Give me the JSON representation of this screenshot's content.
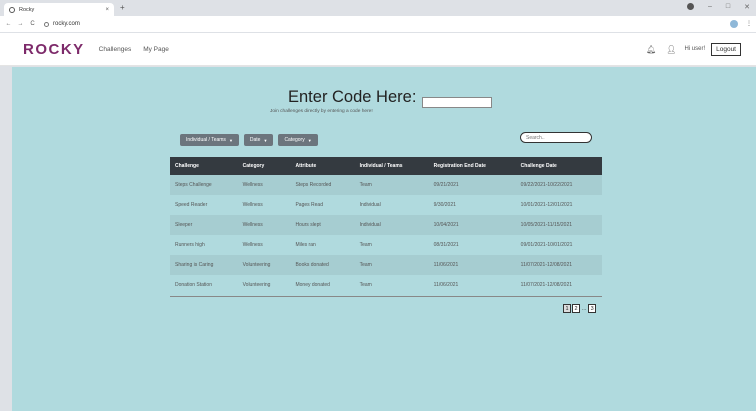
{
  "browser": {
    "tab_title": "Rocky",
    "tab_close": "×",
    "new_tab": "+",
    "url": "rocky.com",
    "nav_back": "←",
    "nav_forward": "→",
    "nav_reload": "C"
  },
  "navbar": {
    "brand": "ROCKY",
    "links": [
      "Challenges",
      "My Page"
    ],
    "greeting": "Hi user!",
    "logout_label": "Logout"
  },
  "main": {
    "heading": "Enter Code Here:",
    "subheading": "Join challenges directly by entering a code here!",
    "code_input_value": "",
    "filters": [
      {
        "label": "Individual / Teams"
      },
      {
        "label": "Date"
      },
      {
        "label": "Category"
      }
    ],
    "search_placeholder": "Search..",
    "table": {
      "columns": [
        "Challenge",
        "Category",
        "Attribute",
        "Individual / Teams",
        "Registration End Date",
        "Challenge Date"
      ],
      "rows": [
        [
          "Steps Challenge",
          "Wellness",
          "Steps Recorded",
          "Team",
          "09/21/2021",
          "09/22/2021-10/22/2021"
        ],
        [
          "Speed Reader",
          "Wellness",
          "Pages Read",
          "Individual",
          "9/30/2021",
          "10/01/2021-12/01/2021"
        ],
        [
          "Sleeper",
          "Wellness",
          "Hours slept",
          "Individual",
          "10/04/2021",
          "10/05/2021-11/15/2021"
        ],
        [
          "Runners high",
          "Wellness",
          "Miles ran",
          "Team",
          "08/31/2021",
          "09/01/2021-10/01/2021"
        ],
        [
          "Sharing is Caring",
          "Volunteering",
          "Books donated",
          "Team",
          "11/06/2021",
          "11/07/2021-12/08/2021"
        ],
        [
          "Donation Station",
          "Volunteering",
          "Money donated",
          "Team",
          "11/06/2021",
          "11/07/2021-12/08/2021"
        ]
      ]
    },
    "pagination": {
      "pages": [
        "1",
        "2",
        "3"
      ],
      "ellipsis": "...",
      "current": "1"
    }
  }
}
